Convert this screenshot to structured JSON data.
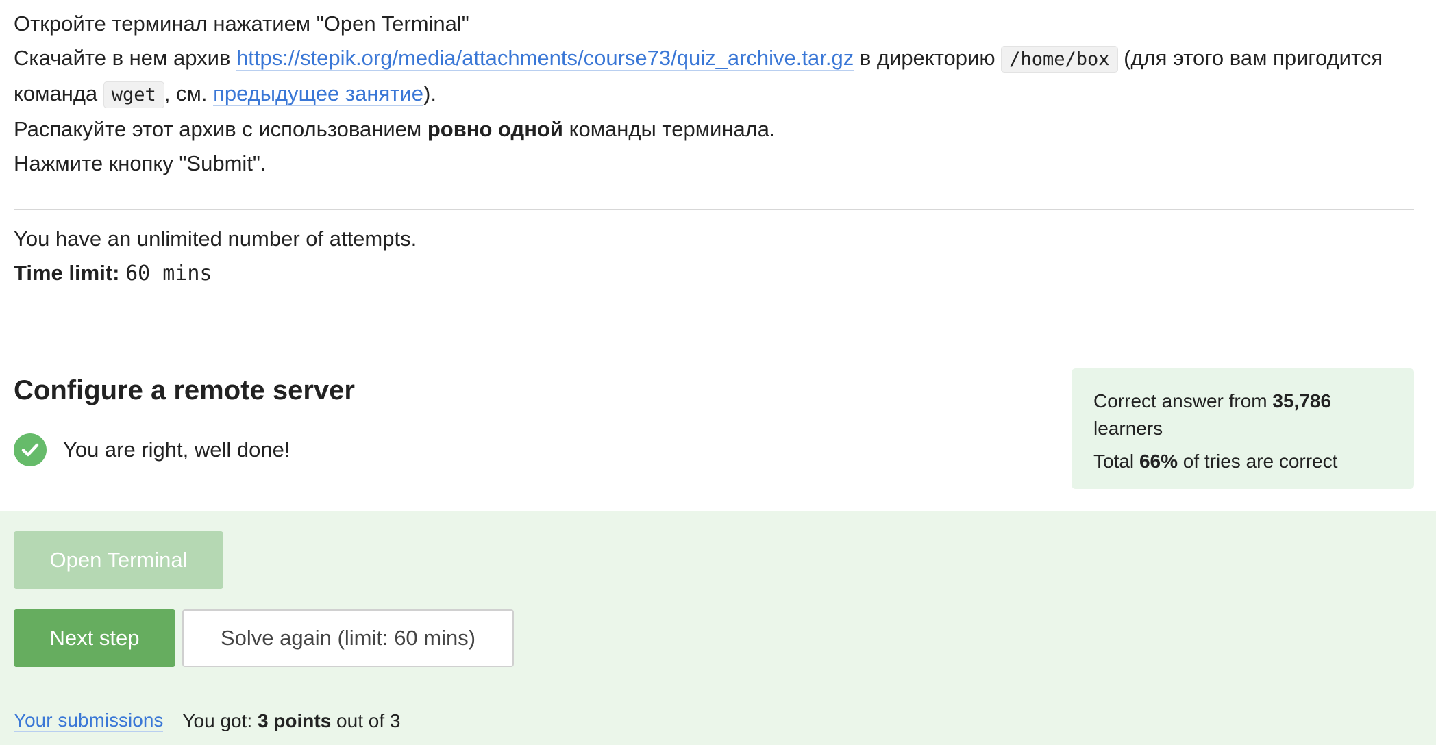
{
  "instructions": {
    "line1": "Откройте терминал нажатием \"Open Terminal\"",
    "line2_prefix": "Скачайте в нем архив ",
    "archive_url": "https://stepik.org/media/attachments/course73/quiz_archive.tar.gz",
    "line2_middle": " в директорию ",
    "directory": "/home/box",
    "line2_suffix": " (для этого вам пригодится команда ",
    "command": "wget",
    "line2_after_command": ", см. ",
    "previous_lesson_link": "предыдущее занятие",
    "line2_end": ").",
    "line3_prefix": "Распакуйте этот архив с использованием ",
    "line3_bold": "ровно одной",
    "line3_suffix": " команды терминала.",
    "line4": "Нажмите кнопку \"Submit\"."
  },
  "attempts": {
    "text": "You have an unlimited number of attempts.",
    "time_limit_label": "Time limit:",
    "time_limit_value": "60 mins"
  },
  "step": {
    "title": "Configure a remote server",
    "result_message": "You are right, well done!"
  },
  "stats": {
    "correct_prefix": "Correct answer from ",
    "learners_count": "35,786",
    "learners_suffix": " learners",
    "total_prefix": "Total ",
    "total_percent": "66%",
    "total_suffix": " of tries are correct"
  },
  "actions": {
    "open_terminal": "Open Terminal",
    "next_step": "Next step",
    "solve_again": "Solve again (limit: 60 mins)"
  },
  "footer": {
    "submissions_link": "Your submissions",
    "score_prefix": "You got: ",
    "score_bold": "3 points",
    "score_suffix": " out of 3"
  },
  "colors": {
    "link": "#3a77d6",
    "success_green": "#66bb6a",
    "action_background": "#ebf6ea",
    "primary_button": "#66ad5f",
    "disabled_button": "#b5d8b3"
  }
}
